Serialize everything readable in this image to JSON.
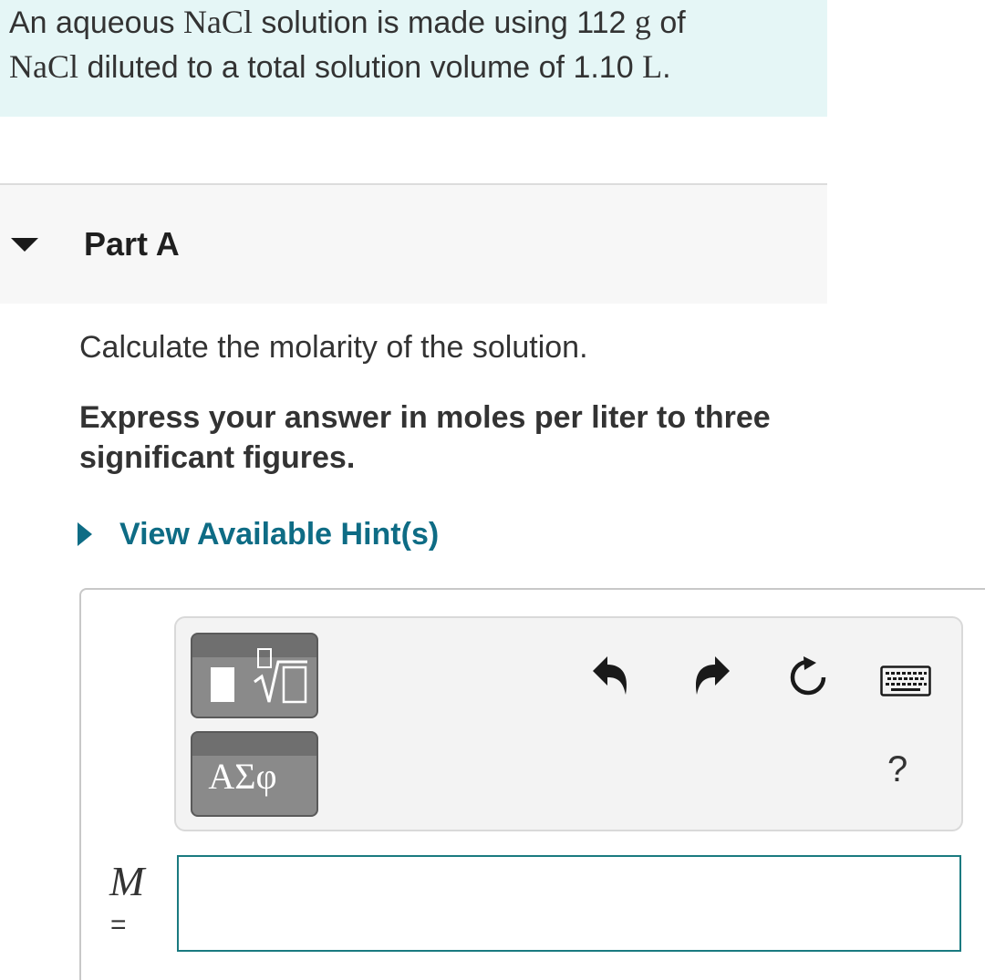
{
  "problem": {
    "line1_prefix": "An aqueous ",
    "compound": "NaCl",
    "line1_mid": " solution is made using 112 ",
    "mass_unit": "g",
    "line1_suffix": " of",
    "line2_suffix": " diluted to a total solution volume of 1.10 ",
    "volume_unit": "L",
    "period": "."
  },
  "part": {
    "title": "Part A"
  },
  "question": "Calculate the molarity of the solution.",
  "instruction": "Express your answer in moles per liter to three significant figures.",
  "hint": {
    "label": "View Available Hint(s)"
  },
  "toolbar": {
    "templates_icon": "templates-icon",
    "greek_label": "ΑΣφ",
    "undo_icon": "undo-icon",
    "redo_icon": "redo-icon",
    "reset_icon": "reset-icon",
    "keyboard_icon": "keyboard-icon",
    "help_label": "?"
  },
  "answer": {
    "variable": "M",
    "equals": "=",
    "value": ""
  },
  "colors": {
    "problem_bg": "#e5f6f6",
    "link": "#0e6c85",
    "input_border": "#1a7a80"
  }
}
